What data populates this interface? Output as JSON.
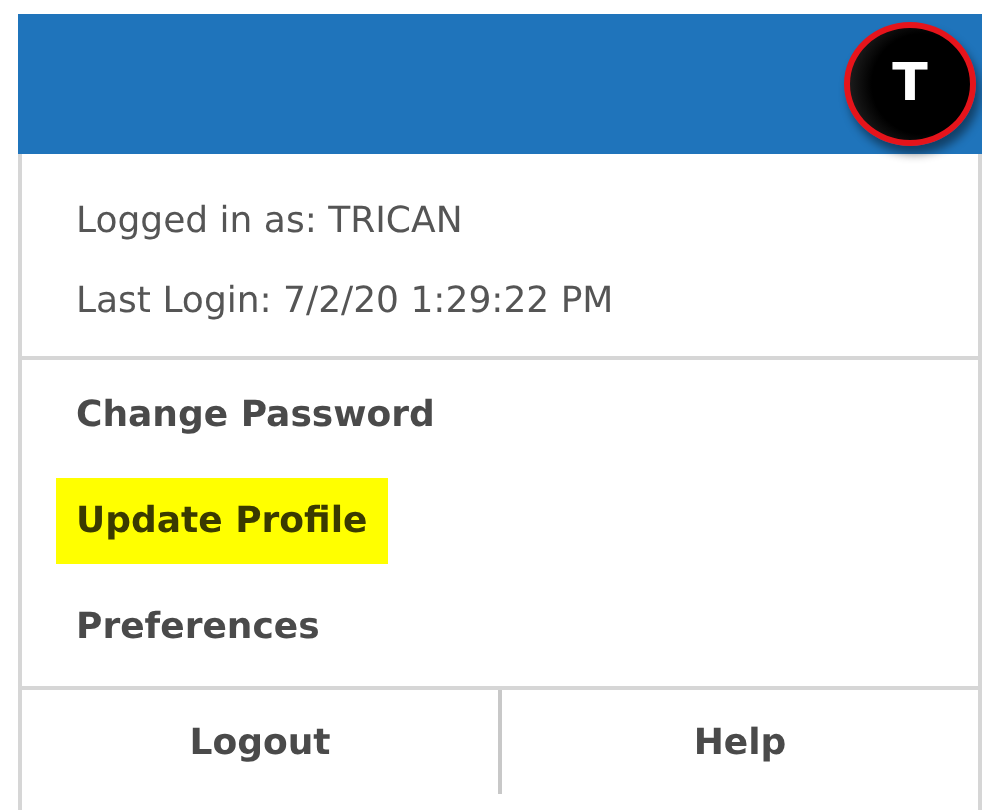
{
  "header": {
    "avatar_letter": "T"
  },
  "user_info": {
    "logged_in_as": "Logged in as: TRICAN",
    "last_login": "Last Login: 7/2/20 1:29:22 PM"
  },
  "menu_items": [
    {
      "label": "Change Password",
      "highlighted": false
    },
    {
      "label": "Update Profile",
      "highlighted": true
    },
    {
      "label": "Preferences",
      "highlighted": false
    }
  ],
  "footer_buttons": [
    "Logout",
    "Help"
  ]
}
